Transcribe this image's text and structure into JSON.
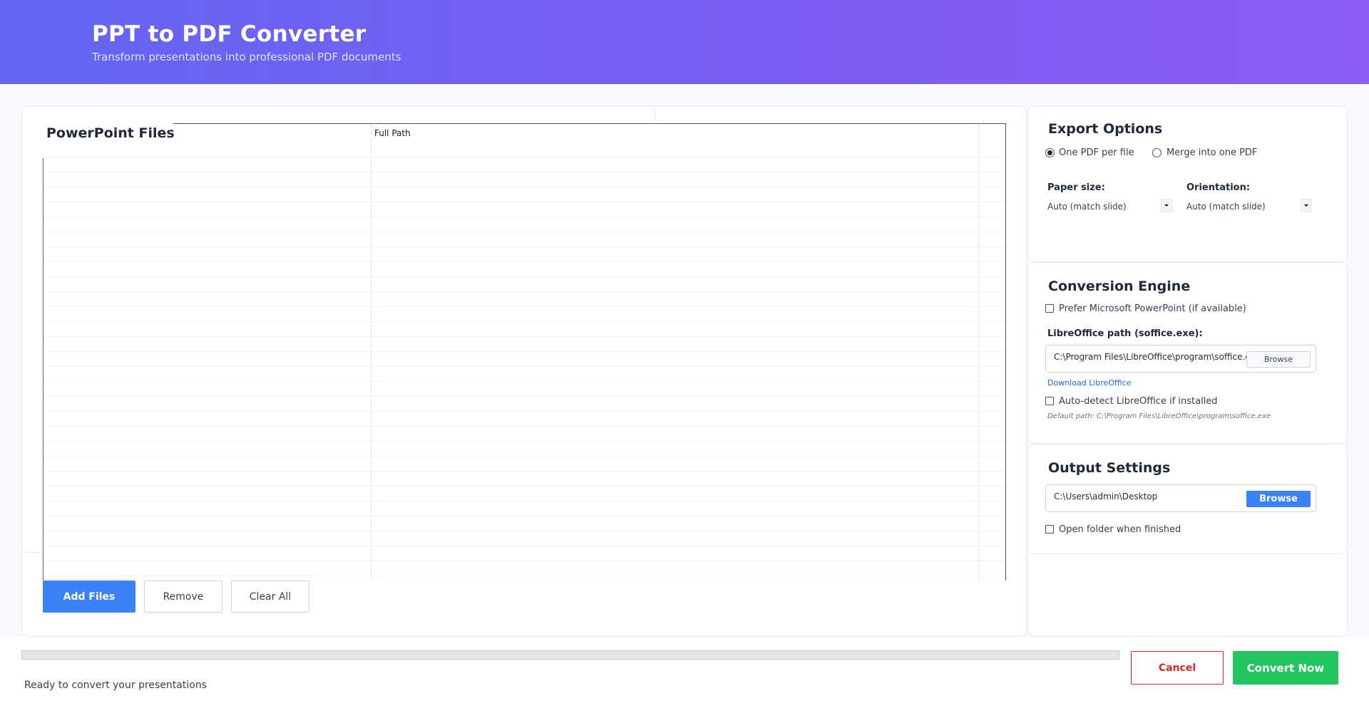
{
  "header": {
    "title": "PPT to PDF Converter",
    "subtitle": "Transform presentations into professional PDF documents"
  },
  "files": {
    "title": "PowerPoint Files",
    "columns": [
      "",
      "Full Path"
    ],
    "rows": [],
    "add_label": "Add Files",
    "remove_label": "Remove",
    "clear_label": "Clear All"
  },
  "export": {
    "title": "Export Options",
    "modes": [
      {
        "label": "One PDF per file",
        "checked": true
      },
      {
        "label": "Merge into one PDF",
        "checked": false
      }
    ],
    "paper_size_label": "Paper size:",
    "paper_size_value": "Auto (match slide)",
    "orientation_label": "Orientation:",
    "orientation_value": "Auto (match slide)"
  },
  "engine": {
    "title": "Conversion Engine",
    "prefer_powerpoint_label": "Prefer Microsoft PowerPoint (if available)",
    "prefer_powerpoint_checked": false,
    "libre_path_label": "LibreOffice path (soffice.exe):",
    "libre_path_value": "C:\\Program Files\\LibreOffice\\program\\soffice.exe",
    "browse_label": "Browse",
    "download_link": "Download LibreOffice",
    "auto_detect_label": "Auto-detect LibreOffice if installed",
    "auto_detect_checked": false,
    "default_path_hint": "Default path: C:\\Program Files\\LibreOffice\\program\\soffice.exe"
  },
  "output": {
    "title": "Output Settings",
    "path_value": "C:\\Users\\admin\\Desktop",
    "browse_label": "Browse",
    "open_folder_label": "Open folder when finished",
    "open_folder_checked": false
  },
  "footer": {
    "progress": 0,
    "status": "Ready to convert your presentations",
    "cancel_label": "Cancel",
    "convert_label": "Convert Now"
  },
  "colors": {
    "accent": "#3b82f6",
    "header_start": "#6366f1",
    "header_end": "#8b5cf6",
    "cancel": "#dc2626",
    "convert": "#22c55e"
  }
}
